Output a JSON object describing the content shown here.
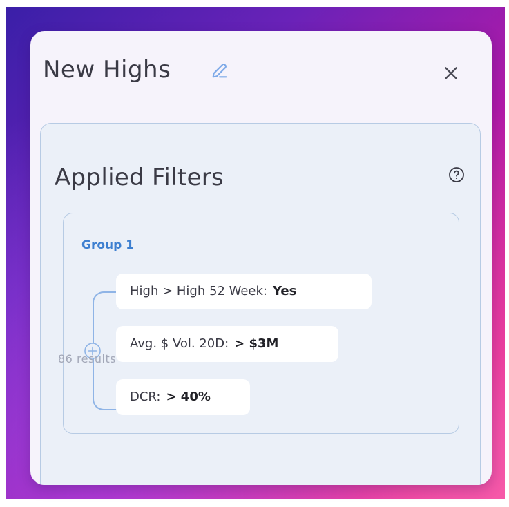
{
  "header": {
    "title": "New Highs",
    "edit_icon": "edit-icon",
    "close_icon": "close-icon"
  },
  "filters": {
    "title": "Applied Filters",
    "help_icon": "question-circle-icon",
    "group": {
      "label": "Group 1",
      "add_icon": "plus-circle-icon",
      "items": [
        {
          "label": "High > High 52 Week:",
          "value": "Yes"
        },
        {
          "label": "Avg. $ Vol. 20D:",
          "value": "> $3M"
        },
        {
          "label": "DCR:",
          "value": "> 40%"
        }
      ]
    },
    "results_text": "86 results"
  },
  "colors": {
    "accent": "#3d7fd0",
    "tree_line": "#8fb4e6",
    "panel_border": "#b7cbe4",
    "card_bg": "#f6f3fb",
    "panel_bg": "#ebf0f8"
  }
}
